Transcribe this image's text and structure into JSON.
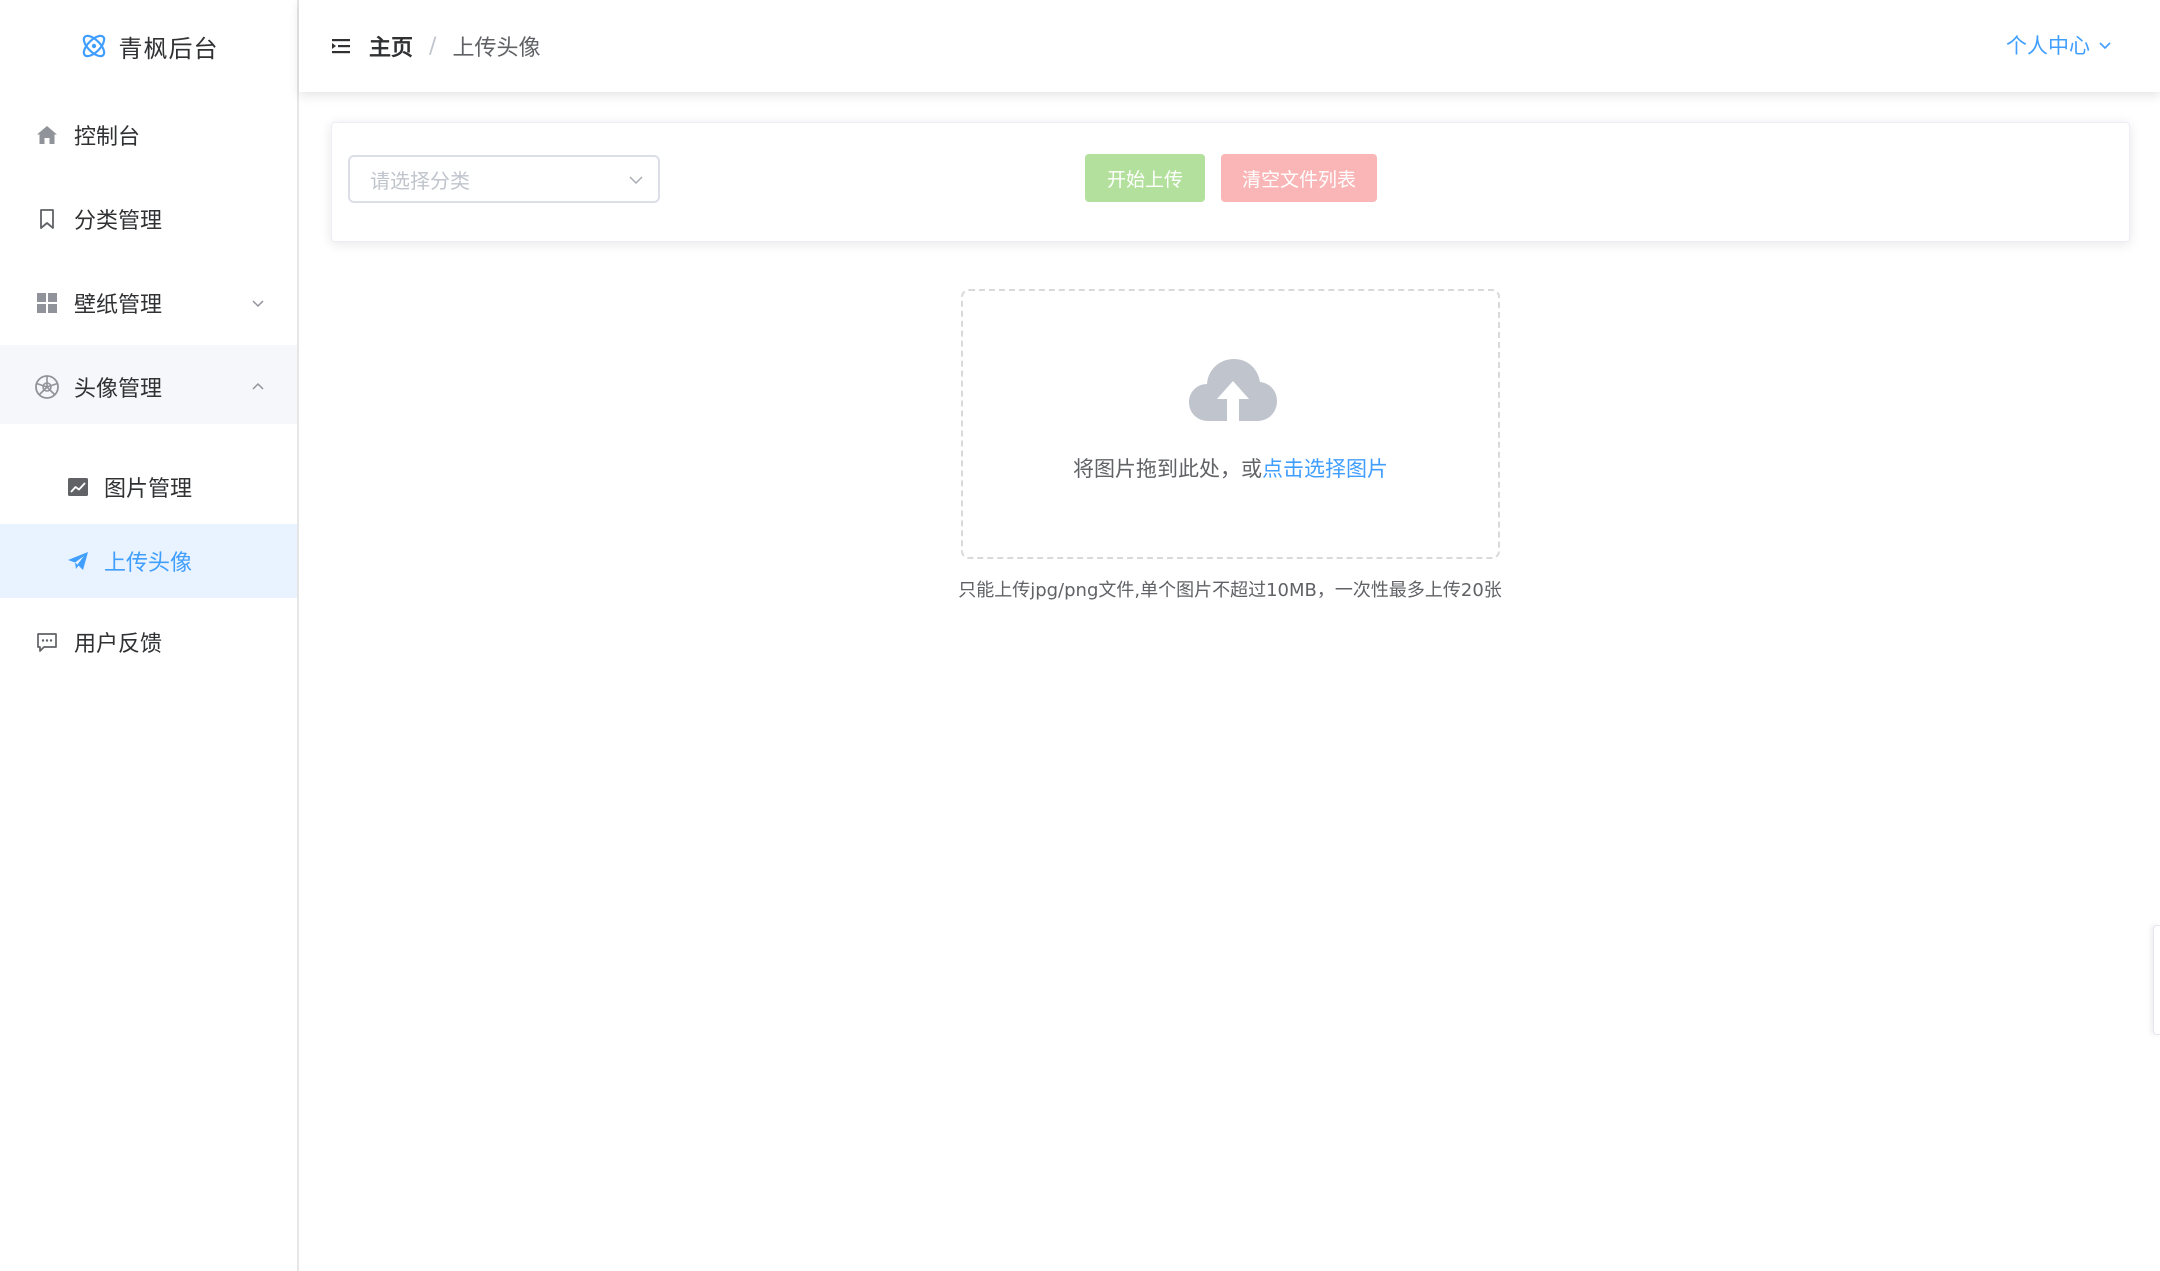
{
  "brand": {
    "title": "青枫后台",
    "logo_icon": "atom-logo-icon",
    "logo_color": "#409eff"
  },
  "sidebar": {
    "items": [
      {
        "label": "控制台",
        "icon": "home-icon"
      },
      {
        "label": "分类管理",
        "icon": "bookmark-icon"
      },
      {
        "label": "壁纸管理",
        "icon": "grid-icon",
        "expandable": true,
        "expanded": false
      },
      {
        "label": "头像管理",
        "icon": "aperture-icon",
        "expandable": true,
        "expanded": true,
        "children": [
          {
            "label": "图片管理",
            "icon": "image-chart-icon",
            "active": false
          },
          {
            "label": "上传头像",
            "icon": "paper-plane-icon",
            "active": true
          }
        ]
      },
      {
        "label": "用户反馈",
        "icon": "chat-icon"
      }
    ]
  },
  "header": {
    "collapse_icon": "menu-fold-icon",
    "breadcrumb": {
      "home": "主页",
      "separator": "/",
      "current": "上传头像"
    },
    "user_menu": {
      "label": "个人中心",
      "icon": "chevron-down-icon"
    }
  },
  "toolbar": {
    "category_select": {
      "placeholder": "请选择分类",
      "value": ""
    },
    "start_upload_label": "开始上传",
    "clear_list_label": "清空文件列表"
  },
  "upload": {
    "icon": "cloud-upload-icon",
    "drop_text": "将图片拖到此处，或",
    "drop_link": "点击选择图片",
    "tip": "只能上传jpg/png文件,单个图片不超过10MB，一次性最多上传20张"
  },
  "colors": {
    "primary": "#409eff",
    "success_disabled": "#b3e19d",
    "danger_disabled": "#fab6b6",
    "active_bg": "#e8f3ff"
  }
}
